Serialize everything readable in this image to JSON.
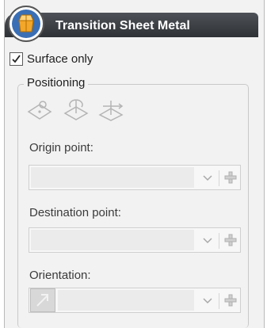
{
  "header": {
    "title": "Transition Sheet Metal",
    "logo_icon": "transition-sheet-metal-icon"
  },
  "surface_only": {
    "label": "Surface only",
    "checked": true
  },
  "positioning": {
    "title": "Positioning",
    "operation_icons": [
      "plane-point-icon",
      "rotate-plane-icon",
      "move-plane-icon"
    ]
  },
  "origin_point": {
    "label": "Origin point:",
    "value": ""
  },
  "destination_point": {
    "label": "Destination point:",
    "value": ""
  },
  "orientation": {
    "label": "Orientation:",
    "value": "",
    "direction_icon": "diagonal-arrow-icon"
  },
  "colors": {
    "title_bar": "#3a3d42",
    "panel_bg": "#f2f2f2",
    "accent_orange": "#f2a62a",
    "logo_blue": "#3a6fb5"
  }
}
